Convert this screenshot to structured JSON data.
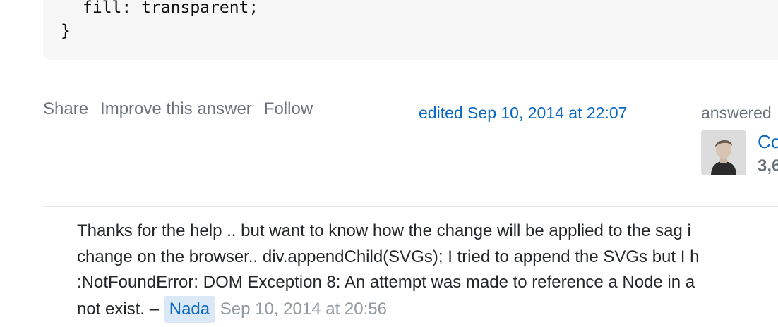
{
  "code": {
    "line1": "fill: transparent;",
    "line2": "}"
  },
  "post_menu": {
    "share": "Share",
    "improve": "Improve this answer",
    "follow": "Follow"
  },
  "edited": "edited Sep 10, 2014 at 22:07",
  "answered": {
    "label": "answered",
    "user_name": "Co",
    "user_rep": "3,6"
  },
  "comment": {
    "line1": "Thanks for the help .. but want to know how the change will be applied to the sag i",
    "line2": "change on the browser.. div.appendChild(SVGs); I tried to append the SVGs but I h",
    "line3": ":NotFoundError: DOM Exception 8: An attempt was made to reference a Node in a",
    "line4_text": "not exist. –",
    "user": "Nada",
    "date": "Sep 10, 2014 at 20:56"
  },
  "colors": {
    "link": "#0a68c4",
    "muted": "#6a737c",
    "code_bg": "#f6f6f6",
    "user_highlight": "#dbe9f7"
  }
}
